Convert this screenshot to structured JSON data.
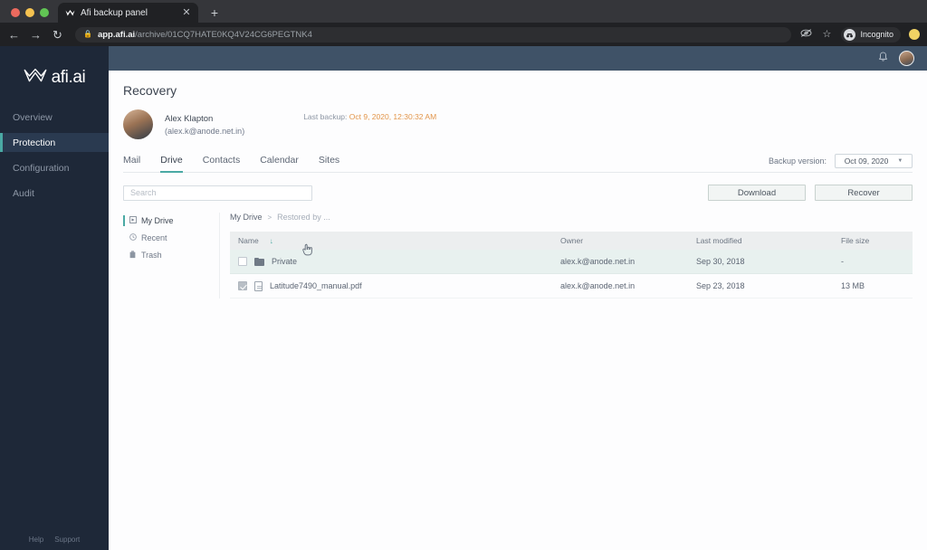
{
  "browser": {
    "tab": {
      "title": "Afi backup panel",
      "favicon_icon": "afi-crown-icon",
      "close_icon": "close-icon"
    },
    "new_tab_icon": "plus-icon",
    "nav": {
      "back_icon": "arrow-left-icon",
      "forward_icon": "arrow-right-icon",
      "reload_icon": "reload-icon"
    },
    "omnibox": {
      "lock_icon": "lock-icon",
      "host": "app.afi.ai",
      "path": "/archive/01CQ7HATE0KQ4V24CG6PEGTNK4"
    },
    "toolbar_icons": {
      "block_icon": "eye-slash-icon",
      "bookmark_icon": "star-icon"
    },
    "incognito": {
      "label": "Incognito",
      "icon": "incognito-icon"
    },
    "profile_icon": "profile-avatar-icon"
  },
  "sidebar": {
    "logo_text": "afi.ai",
    "logo_icon": "afi-crown-logo-icon",
    "items": [
      {
        "label": "Overview",
        "active": false
      },
      {
        "label": "Protection",
        "active": true
      },
      {
        "label": "Configuration",
        "active": false
      },
      {
        "label": "Audit",
        "active": false
      }
    ],
    "footer": {
      "help": "Help",
      "support": "Support"
    }
  },
  "topbar": {
    "bell_icon": "bell-icon",
    "avatar_icon": "user-avatar-icon"
  },
  "page": {
    "title": "Recovery",
    "user": {
      "avatar_icon": "user-photo-icon",
      "name": "Alex Klapton",
      "email": "(alex.k@anode.net.in)"
    },
    "last_backup": {
      "label": "Last backup:",
      "value": "Oct 9, 2020, 12:30:32 AM"
    }
  },
  "tabs": [
    {
      "label": "Mail",
      "active": false
    },
    {
      "label": "Drive",
      "active": true
    },
    {
      "label": "Contacts",
      "active": false
    },
    {
      "label": "Calendar",
      "active": false
    },
    {
      "label": "Sites",
      "active": false
    }
  ],
  "backup_version": {
    "label": "Backup version:",
    "value": "Oct 09, 2020",
    "caret_icon": "chevron-down-icon"
  },
  "search": {
    "value": "",
    "placeholder": "Search"
  },
  "actions": {
    "download": "Download",
    "recover": "Recover"
  },
  "tree": [
    {
      "label": "My Drive",
      "icon": "drive-icon",
      "active": true
    },
    {
      "label": "Recent",
      "icon": "clock-icon",
      "active": false
    },
    {
      "label": "Trash",
      "icon": "trash-icon",
      "active": false
    }
  ],
  "breadcrumb": {
    "root": "My Drive",
    "separator": ">",
    "current": "Restored by ..."
  },
  "table": {
    "headers": {
      "name": "Name",
      "sort_icon": "arrow-down-icon",
      "owner": "Owner",
      "modified": "Last modified",
      "size": "File size"
    },
    "rows": [
      {
        "name": "Private",
        "icon": "folder-icon",
        "checked": false,
        "owner": "alex.k@anode.net.in",
        "modified": "Sep 30, 2018",
        "size": "-",
        "hovered": true
      },
      {
        "name": "Latitude7490_manual.pdf",
        "icon": "pdf-file-icon",
        "checked": true,
        "owner": "alex.k@anode.net.in",
        "modified": "Sep 23, 2018",
        "size": "13 MB",
        "hovered": false
      }
    ]
  },
  "colors": {
    "accent": "#4aa9a4",
    "sidebar_bg": "#1e2838",
    "topbar_bg": "#3f5267",
    "backup_text": "#e2954a"
  }
}
